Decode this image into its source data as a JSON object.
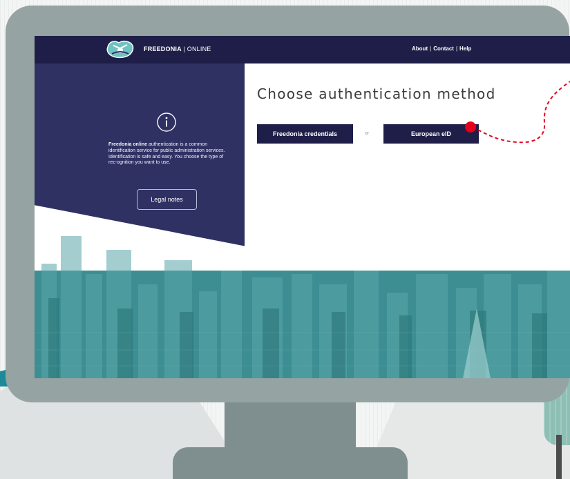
{
  "header": {
    "brand_name": "FREEDONIA",
    "brand_separator": "|",
    "brand_suffix": "ONLINE",
    "nav": [
      {
        "label": "About"
      },
      {
        "label": "Contact"
      },
      {
        "label": "Help"
      }
    ],
    "nav_separator": "|"
  },
  "left_panel": {
    "intro_bold": "Freedonia online",
    "intro_text": " authentication is a common identification service for public administration services. Identification is safe and easy. You choose the type of rec-ognition you want to use.",
    "legal_button": "Legal notes"
  },
  "main": {
    "title": "Choose authentication method",
    "buttons": {
      "freedonia": "Freedonia credentials",
      "or_label": "or",
      "eid": "European eID"
    }
  },
  "colors": {
    "header_bg": "#1f1e48",
    "panel_bg": "#2f3163",
    "city_teal": "#3c8e93",
    "monitor_frame": "#95a4a3",
    "annotation_red": "#e4001b"
  }
}
